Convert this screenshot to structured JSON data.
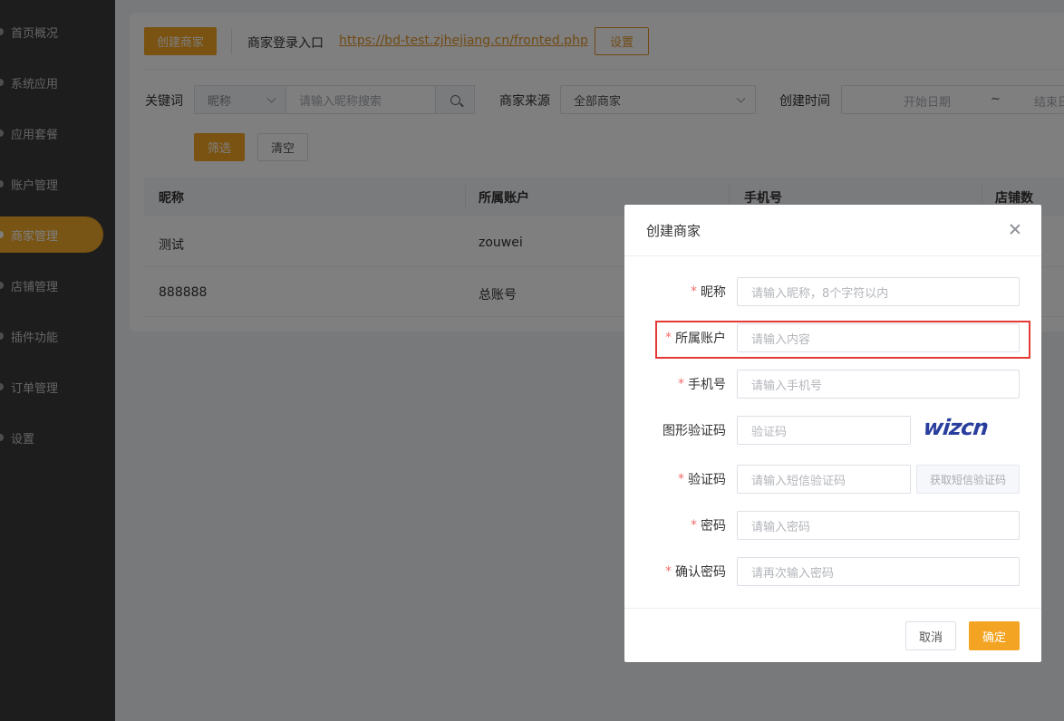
{
  "sidebar": {
    "items": [
      {
        "label": "首页概况"
      },
      {
        "label": "系统应用"
      },
      {
        "label": "应用套餐"
      },
      {
        "label": "账户管理"
      },
      {
        "label": "商家管理",
        "active": true
      },
      {
        "label": "店铺管理"
      },
      {
        "label": "插件功能"
      },
      {
        "label": "订单管理"
      },
      {
        "label": "设置"
      }
    ]
  },
  "toolbar": {
    "create_label": "创建商家",
    "login_entry_label": "商家登录入口",
    "login_url": "https://bd-test.zjhejiang.cn/fronted.php",
    "settings_label": "设置"
  },
  "filters": {
    "keyword_label": "关键词",
    "keyword_type": "昵称",
    "keyword_placeholder": "请输入昵称搜索",
    "source_label": "商家来源",
    "source_value": "全部商家",
    "time_label": "创建时间",
    "start_placeholder": "开始日期",
    "range_sep": "~",
    "end_placeholder": "结束日",
    "filter_label": "筛选",
    "clear_label": "清空"
  },
  "table": {
    "columns": [
      "昵称",
      "所属账户",
      "手机号",
      "店铺数"
    ],
    "rows": [
      {
        "nickname": "测试",
        "account": "zouwei"
      },
      {
        "nickname": "888888",
        "account": "总账号"
      }
    ]
  },
  "modal": {
    "title": "创建商家",
    "required_mark": "*",
    "fields": {
      "nickname": {
        "label": "昵称",
        "placeholder": "请输入昵称，8个字符以内"
      },
      "account": {
        "label": "所属账户",
        "placeholder": "请输入内容"
      },
      "phone": {
        "label": "手机号",
        "placeholder": "请输入手机号"
      },
      "captcha": {
        "label": "图形验证码",
        "placeholder": "验证码",
        "image_text": "wizcn"
      },
      "sms": {
        "label": "验证码",
        "placeholder": "请输入短信验证码",
        "button": "获取短信验证码"
      },
      "password": {
        "label": "密码",
        "placeholder": "请输入密码"
      },
      "confirm": {
        "label": "确认密码",
        "placeholder": "请再次输入密码"
      }
    },
    "cancel_label": "取消",
    "ok_label": "确定"
  },
  "colors": {
    "accent": "#f4a423",
    "sidebar": "#3a3a3a",
    "required": "#f56c6c",
    "highlight": "#e53935"
  }
}
